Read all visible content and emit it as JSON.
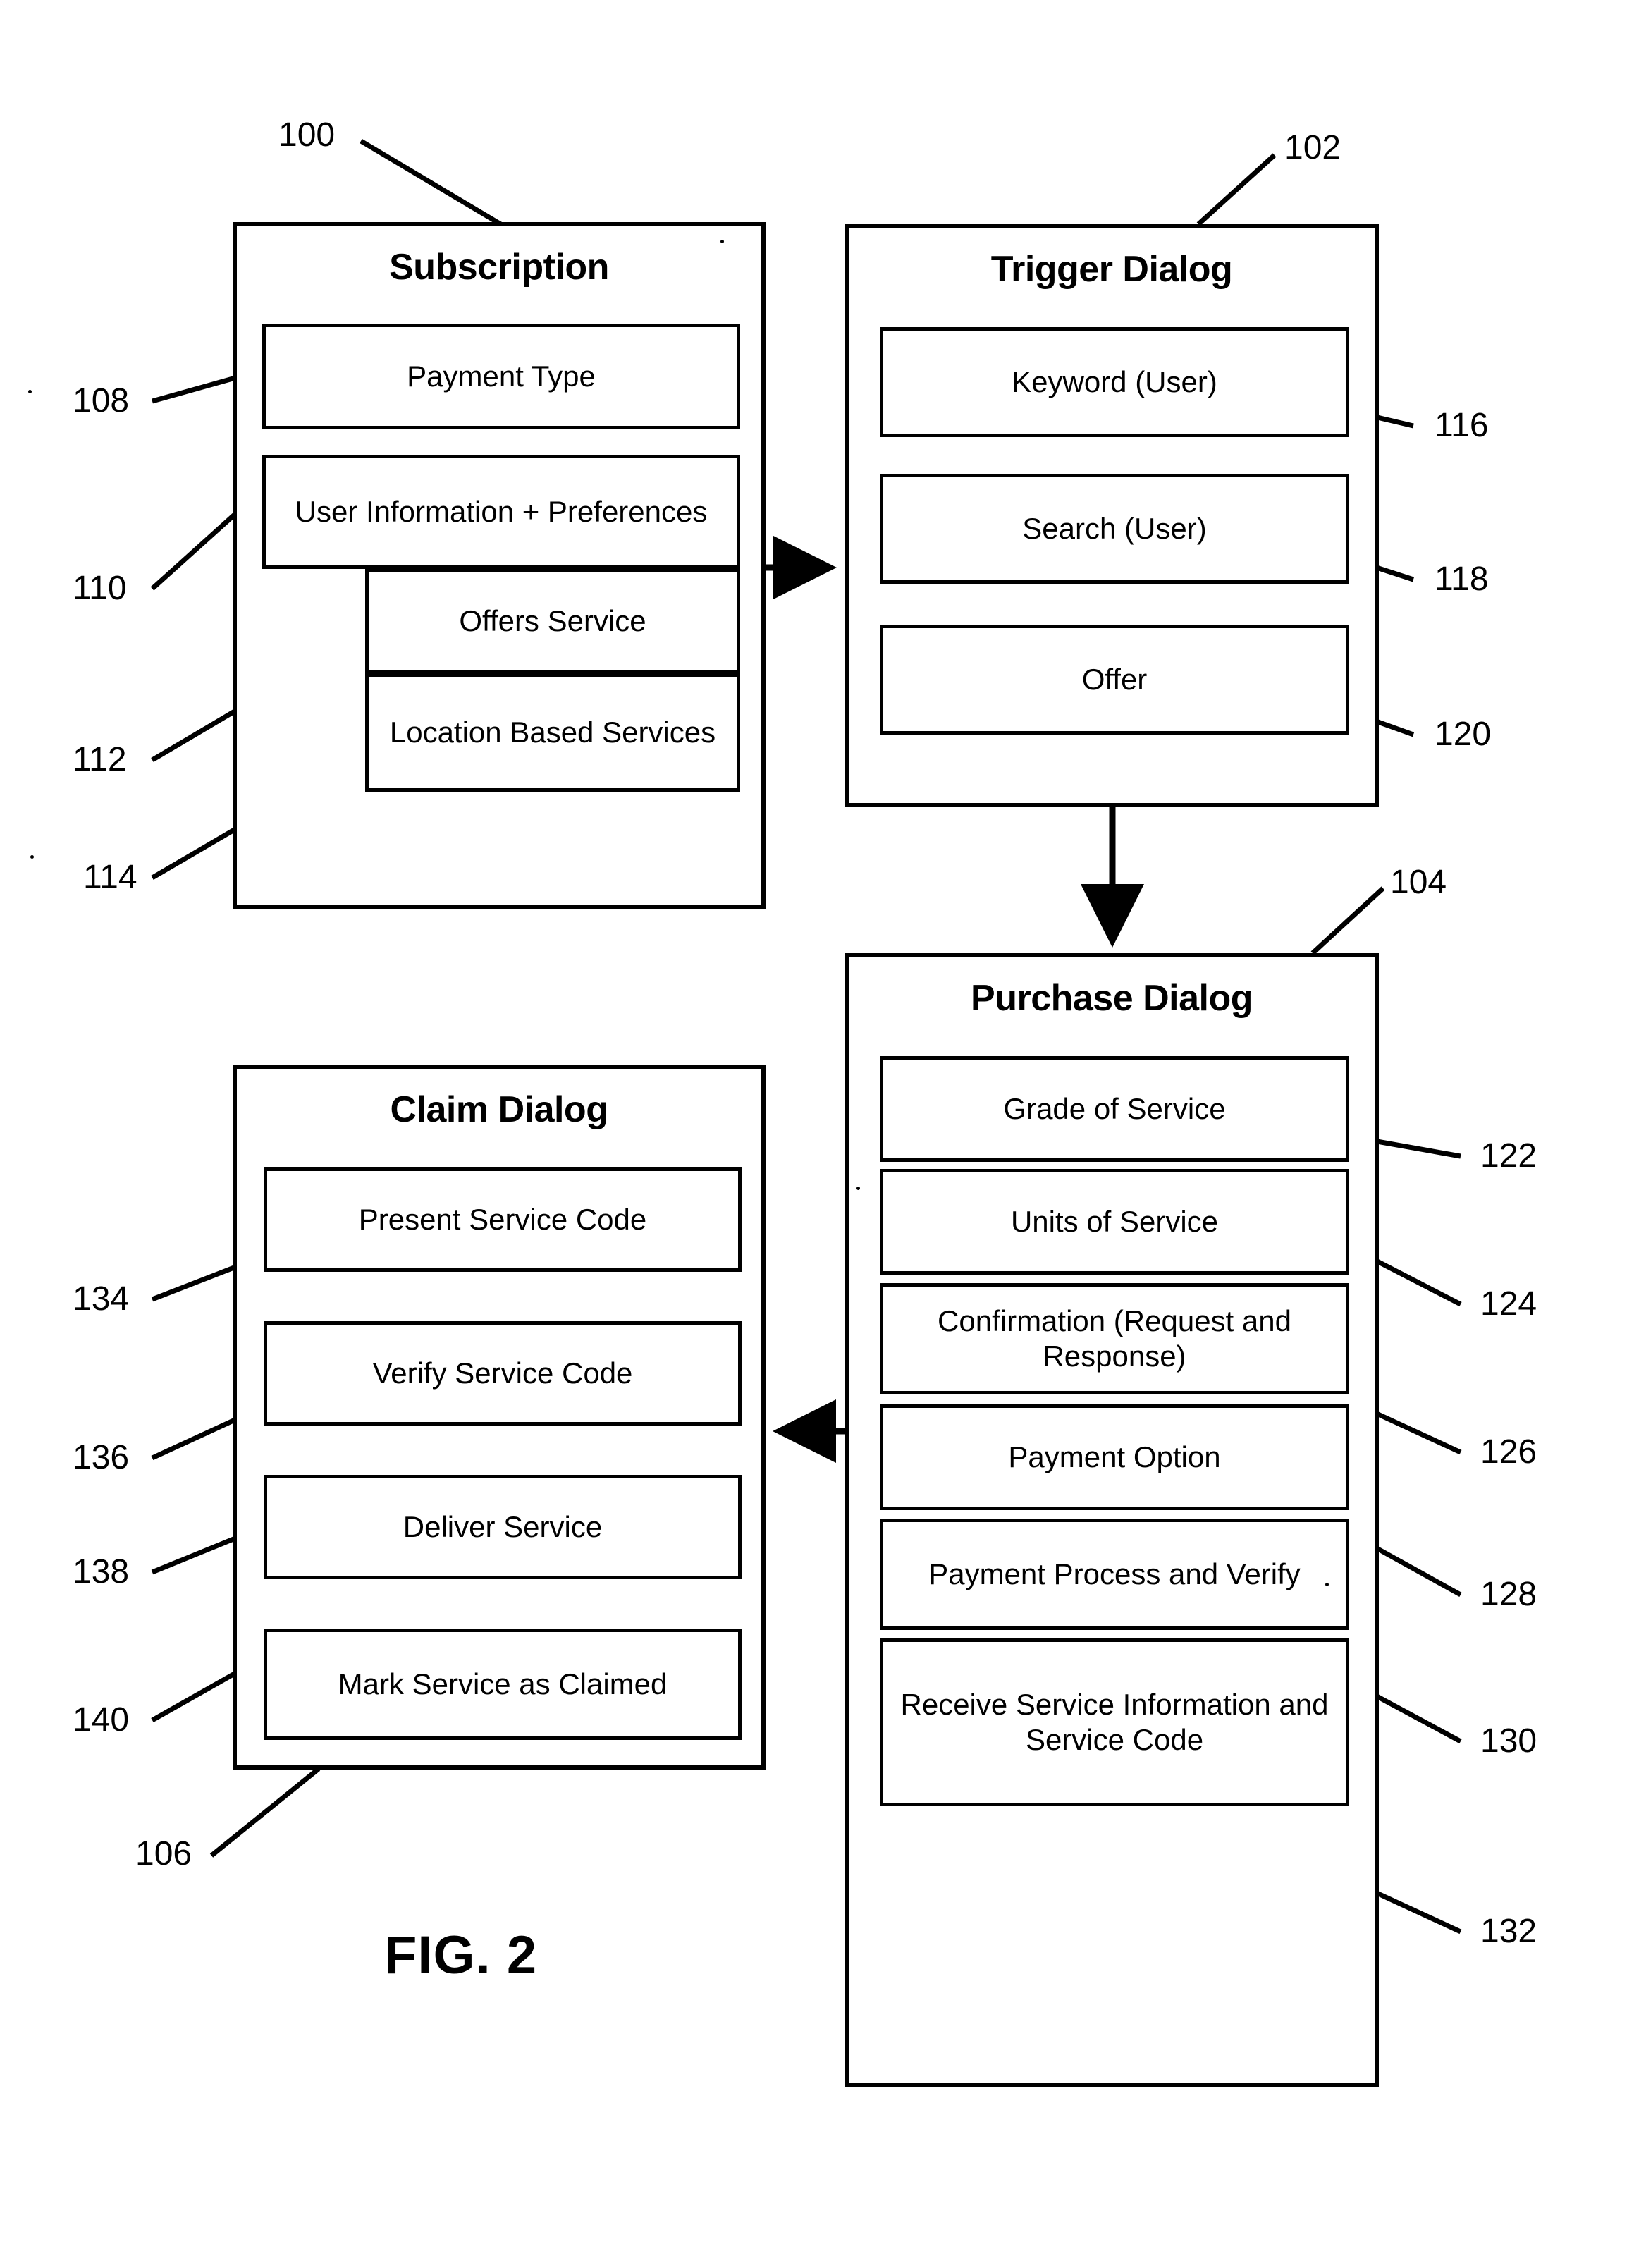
{
  "figure": {
    "caption": "FIG. 2"
  },
  "panels": [
    {
      "id": "subscription",
      "title": "Subscription",
      "ref": "100",
      "items": [
        {
          "id": "payment-type",
          "label": "Payment Type",
          "ref": "108"
        },
        {
          "id": "user-info-prefs",
          "label": "User Information + Preferences",
          "ref": "110"
        },
        {
          "id": "offers-service",
          "label": "Offers Service",
          "ref": "112"
        },
        {
          "id": "location-based",
          "label": "Location Based Services",
          "ref": "114"
        }
      ]
    },
    {
      "id": "trigger-dialog",
      "title": "Trigger Dialog",
      "ref": "102",
      "items": [
        {
          "id": "keyword-user",
          "label": "Keyword (User)",
          "ref": "116"
        },
        {
          "id": "search-user",
          "label": "Search (User)",
          "ref": "118"
        },
        {
          "id": "offer",
          "label": "Offer",
          "ref": "120"
        }
      ]
    },
    {
      "id": "purchase-dialog",
      "title": "Purchase Dialog",
      "ref": "104",
      "items": [
        {
          "id": "grade-of-service",
          "label": "Grade of Service",
          "ref": "122"
        },
        {
          "id": "units-of-service",
          "label": "Units of Service",
          "ref": "124"
        },
        {
          "id": "confirmation",
          "label": "Confirmation (Request and Response)",
          "ref": "126"
        },
        {
          "id": "payment-option",
          "label": "Payment Option",
          "ref": "128"
        },
        {
          "id": "payment-process-verify",
          "label": "Payment Process and Verify",
          "ref": "130"
        },
        {
          "id": "receive-service-info",
          "label": "Receive Service Information and Service Code",
          "ref": "132"
        }
      ]
    },
    {
      "id": "claim-dialog",
      "title": "Claim Dialog",
      "ref": "106",
      "items": [
        {
          "id": "present-service-code",
          "label": "Present Service Code",
          "ref": "134"
        },
        {
          "id": "verify-service-code",
          "label": "Verify Service Code",
          "ref": "136"
        },
        {
          "id": "deliver-service",
          "label": "Deliver Service",
          "ref": "138"
        },
        {
          "id": "mark-service-claimed",
          "label": "Mark Service as Claimed",
          "ref": "140"
        }
      ]
    }
  ],
  "flow_arrows": [
    {
      "id": "subscription-to-trigger",
      "from": "subscription",
      "to": "trigger-dialog",
      "direction": "right"
    },
    {
      "id": "trigger-to-purchase",
      "from": "trigger-dialog",
      "to": "purchase-dialog",
      "direction": "down"
    },
    {
      "id": "purchase-to-claim",
      "from": "purchase-dialog",
      "to": "claim-dialog",
      "direction": "left"
    }
  ],
  "colors": {
    "ink": "#000000",
    "background": "#ffffff"
  }
}
